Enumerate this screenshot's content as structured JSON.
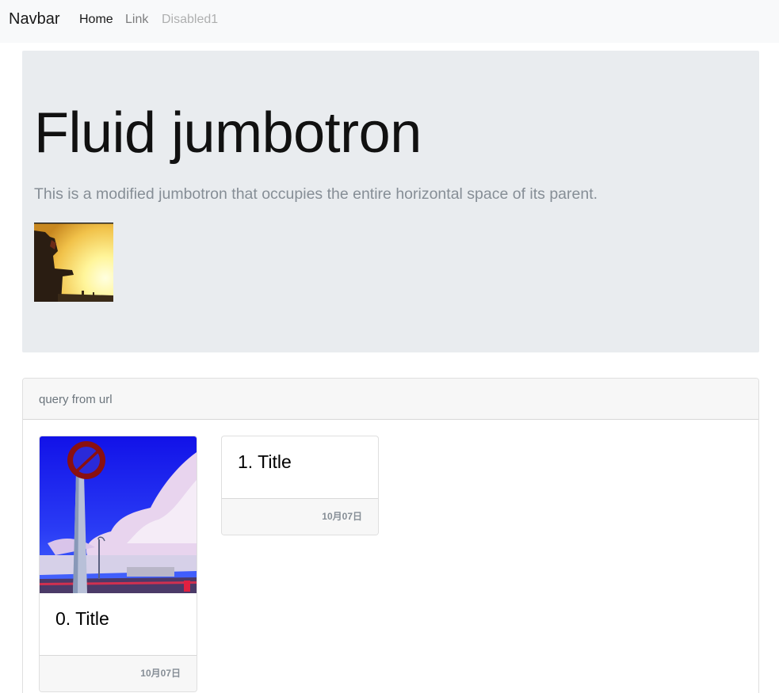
{
  "navbar": {
    "brand": "Navbar",
    "items": [
      {
        "label": "Home"
      },
      {
        "label": "Link"
      },
      {
        "label": "Disabled1"
      }
    ]
  },
  "jumbotron": {
    "title": "Fluid jumbotron",
    "lead": "This is a modified jumbotron that occupies the entire horizontal space of its parent."
  },
  "panel": {
    "header": "query from url",
    "cards": [
      {
        "title": "0. Title",
        "date": "10月07日"
      },
      {
        "title": "1. Title",
        "date": "10月07日"
      }
    ]
  },
  "colors": {
    "navbar_bg": "#f8f9fa",
    "jumbotron_bg": "#e9ecef",
    "card_footer_bg": "#f7f7f7",
    "muted_text": "#868e96"
  }
}
